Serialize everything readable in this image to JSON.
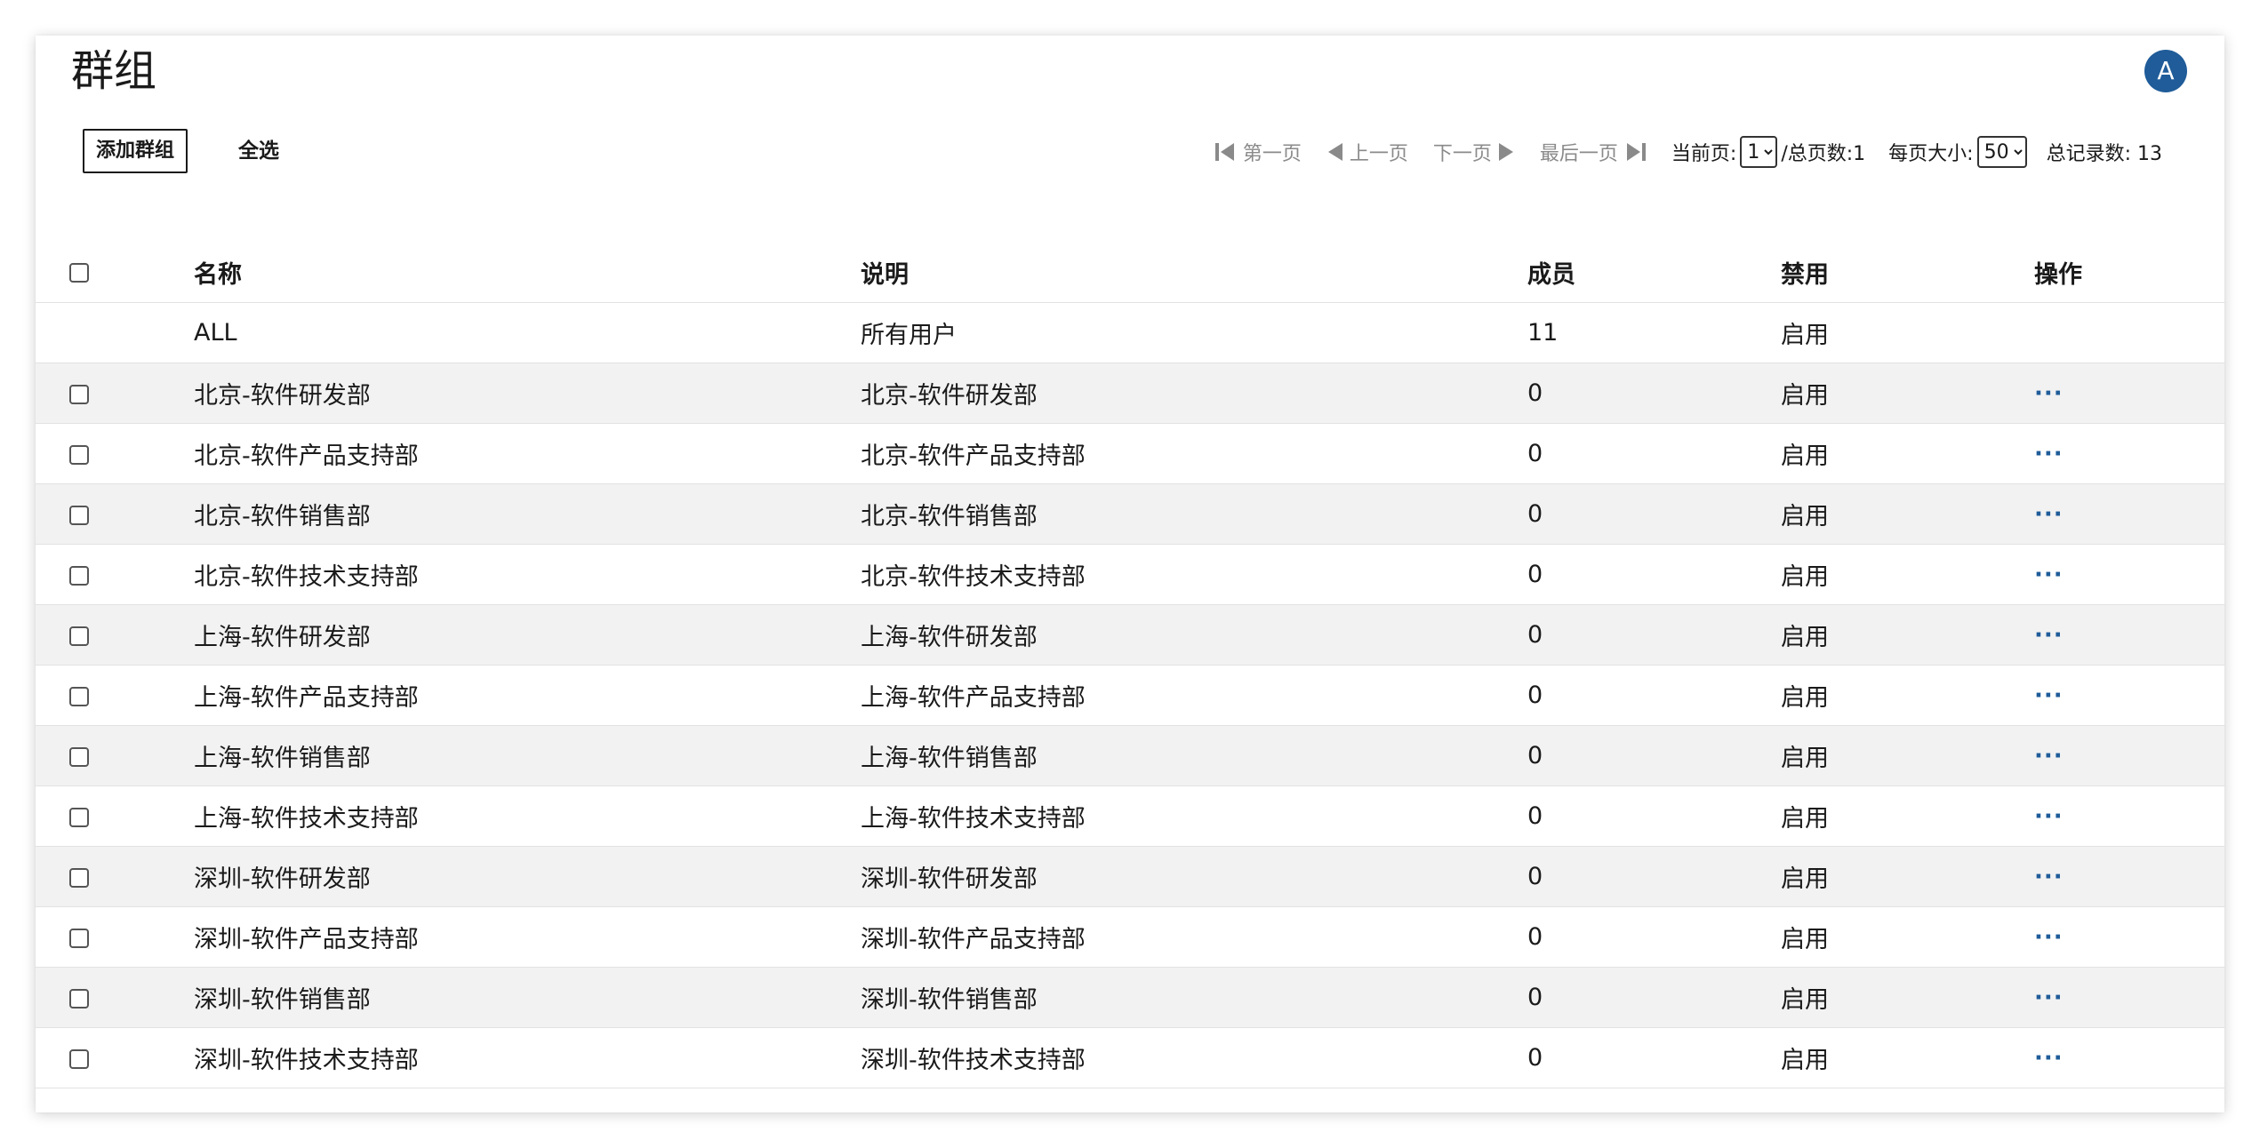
{
  "page": {
    "title": "群组",
    "avatar_letter": "A"
  },
  "toolbar": {
    "add_label": "添加群组",
    "select_all_label": "全选"
  },
  "pagination": {
    "first_label": "第一页",
    "prev_label": "上一页",
    "next_label": "下一页",
    "last_label": "最后一页",
    "current_page_label": "当前页:",
    "current_page": "1",
    "total_pages_label": "/总页数:1",
    "page_size_label": "每页大小:",
    "page_size": "50",
    "total_records_label": "总记录数: 13"
  },
  "table": {
    "headers": {
      "name": "名称",
      "description": "说明",
      "members": "成员",
      "disabled": "禁用",
      "actions": "操作"
    },
    "rows": [
      {
        "name": "ALL",
        "description": "所有用户",
        "members": "11",
        "disabled": "启用",
        "selectable": false,
        "action": ""
      },
      {
        "name": "北京-软件研发部",
        "description": "北京-软件研发部",
        "members": "0",
        "disabled": "启用",
        "selectable": true,
        "action": "···"
      },
      {
        "name": "北京-软件产品支持部",
        "description": "北京-软件产品支持部",
        "members": "0",
        "disabled": "启用",
        "selectable": true,
        "action": "···"
      },
      {
        "name": "北京-软件销售部",
        "description": "北京-软件销售部",
        "members": "0",
        "disabled": "启用",
        "selectable": true,
        "action": "···"
      },
      {
        "name": "北京-软件技术支持部",
        "description": "北京-软件技术支持部",
        "members": "0",
        "disabled": "启用",
        "selectable": true,
        "action": "···"
      },
      {
        "name": "上海-软件研发部",
        "description": "上海-软件研发部",
        "members": "0",
        "disabled": "启用",
        "selectable": true,
        "action": "···"
      },
      {
        "name": "上海-软件产品支持部",
        "description": "上海-软件产品支持部",
        "members": "0",
        "disabled": "启用",
        "selectable": true,
        "action": "···"
      },
      {
        "name": "上海-软件销售部",
        "description": "上海-软件销售部",
        "members": "0",
        "disabled": "启用",
        "selectable": true,
        "action": "···"
      },
      {
        "name": "上海-软件技术支持部",
        "description": "上海-软件技术支持部",
        "members": "0",
        "disabled": "启用",
        "selectable": true,
        "action": "···"
      },
      {
        "name": "深圳-软件研发部",
        "description": "深圳-软件研发部",
        "members": "0",
        "disabled": "启用",
        "selectable": true,
        "action": "···"
      },
      {
        "name": "深圳-软件产品支持部",
        "description": "深圳-软件产品支持部",
        "members": "0",
        "disabled": "启用",
        "selectable": true,
        "action": "···"
      },
      {
        "name": "深圳-软件销售部",
        "description": "深圳-软件销售部",
        "members": "0",
        "disabled": "启用",
        "selectable": true,
        "action": "···"
      },
      {
        "name": "深圳-软件技术支持部",
        "description": "深圳-软件技术支持部",
        "members": "0",
        "disabled": "启用",
        "selectable": true,
        "action": "···"
      }
    ]
  },
  "colors": {
    "accent": "#1f5c99",
    "row_alt": "#f2f2f2",
    "nav_disabled": "#8a8a8a"
  }
}
